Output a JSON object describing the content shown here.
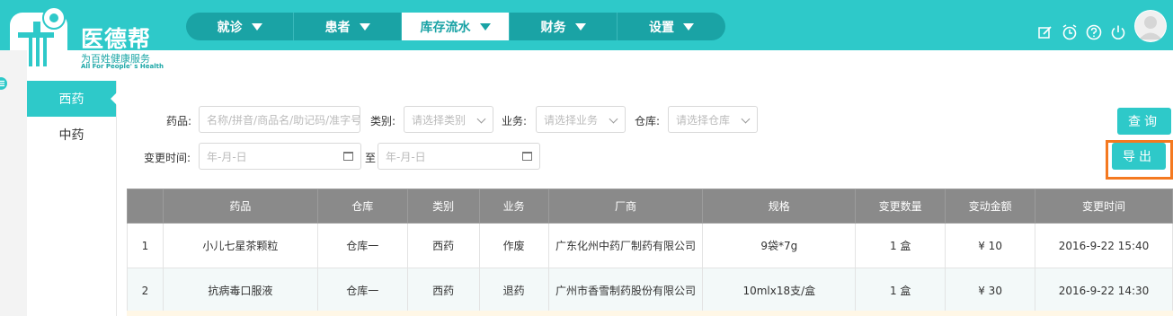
{
  "brand": {
    "title": "医德帮",
    "subtitle": "为百姓健康服务",
    "tagline": "All For People' s Health"
  },
  "nav": [
    {
      "label": "就诊",
      "active": false
    },
    {
      "label": "患者",
      "active": false
    },
    {
      "label": "库存流水",
      "active": true
    },
    {
      "label": "财务",
      "active": false
    },
    {
      "label": "设置",
      "active": false
    }
  ],
  "header_icons": [
    "edit-icon",
    "alarm-icon",
    "help-icon",
    "power-icon"
  ],
  "sidebar": {
    "items": [
      {
        "label": "西药",
        "active": true
      },
      {
        "label": "中药",
        "active": false
      }
    ]
  },
  "filters": {
    "drug_label": "药品:",
    "drug_placeholder": "名称/拼音/商品名/助记码/准字号",
    "category_label": "类别:",
    "category_placeholder": "请选择类别",
    "business_label": "业务:",
    "business_placeholder": "请选择业务",
    "warehouse_label": "仓库:",
    "warehouse_placeholder": "请选择仓库",
    "time_label": "变更时间:",
    "date_from_placeholder": "年-月-日",
    "to_label": "至",
    "date_to_placeholder": "年-月-日"
  },
  "buttons": {
    "query": "查询",
    "export": "导出"
  },
  "table": {
    "headers": [
      "",
      "药品",
      "仓库",
      "类别",
      "业务",
      "厂商",
      "规格",
      "变更数量",
      "变动金额",
      "变更时间"
    ],
    "rows": [
      [
        "1",
        "小儿七星茶颗粒",
        "仓库一",
        "西药",
        "作废",
        "广东化州中药厂制药有限公司",
        "9袋*7g",
        "1 盒",
        "¥ 10",
        "2016-9-22 15:40"
      ],
      [
        "2",
        "抗病毒口服液",
        "仓库一",
        "西药",
        "退药",
        "广州市香雪制药股份有限公司",
        "10mlx18支/盒",
        "1 盒",
        "¥ 30",
        "2016-9-22 14:30"
      ]
    ]
  },
  "colors": {
    "primary": "#2ec9c9",
    "nav_bg": "#1aa3a5",
    "table_header": "#8a8a8a",
    "highlight": "#f47920"
  }
}
